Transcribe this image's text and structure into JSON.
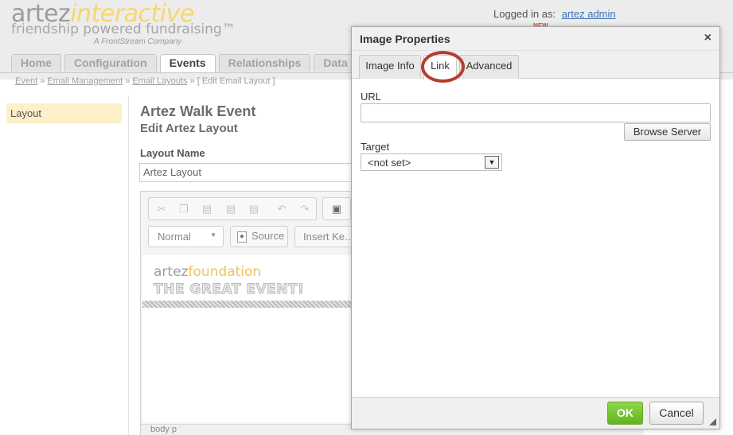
{
  "app": {
    "logo_primary": "artez",
    "logo_secondary": "interactive",
    "tagline": "friendship powered fundraising™",
    "subtitle": "A FrontStream Company",
    "login_label": "Logged in as:",
    "login_user": "artez admin",
    "new_badge": "NEW"
  },
  "nav": {
    "tabs": [
      "Home",
      "Configuration",
      "Events",
      "Relationships",
      "Data En"
    ],
    "active_tab": "Events"
  },
  "breadcrumb": {
    "items": [
      "Event",
      "Email Management",
      "Email Layouts"
    ],
    "current": "[ Edit Email Layout ]",
    "separator": "»"
  },
  "sidebar": {
    "items": [
      {
        "label": "Layout",
        "selected": true
      }
    ]
  },
  "main": {
    "event_title": "Artez Walk Event",
    "edit_title": "Edit Artez Layout",
    "layout_name_label": "Layout Name",
    "layout_name_value": "Artez Layout"
  },
  "editor": {
    "format_value": "Normal",
    "source_label": "Source",
    "insert_label": "Insert Ke...",
    "content_logo_a": "artez",
    "content_logo_b": "foundation",
    "content_heading": "THE GREAT EVENT!",
    "status_path": "body   p"
  },
  "dialog": {
    "title": "Image Properties",
    "close_glyph": "×",
    "tabs": [
      "Image Info",
      "Link",
      "Advanced"
    ],
    "active_tab": "Link",
    "url_label": "URL",
    "url_value": "",
    "browse_label": "Browse Server",
    "target_label": "Target",
    "target_value": "<not set>",
    "ok_label": "OK",
    "cancel_label": "Cancel"
  },
  "colors": {
    "accent_green": "#62b321",
    "highlight_circle": "#b83d2c",
    "sidebar_selected": "#fdf0c8",
    "link_blue": "#3b73b9"
  },
  "icons": [
    "cut-icon",
    "copy-icon",
    "paste-icon",
    "paste-text-icon",
    "paste-word-icon",
    "undo-icon",
    "redo-icon",
    "image-icon",
    "source-icon",
    "dropdown-arrow-icon",
    "close-icon",
    "resize-grip-icon"
  ]
}
